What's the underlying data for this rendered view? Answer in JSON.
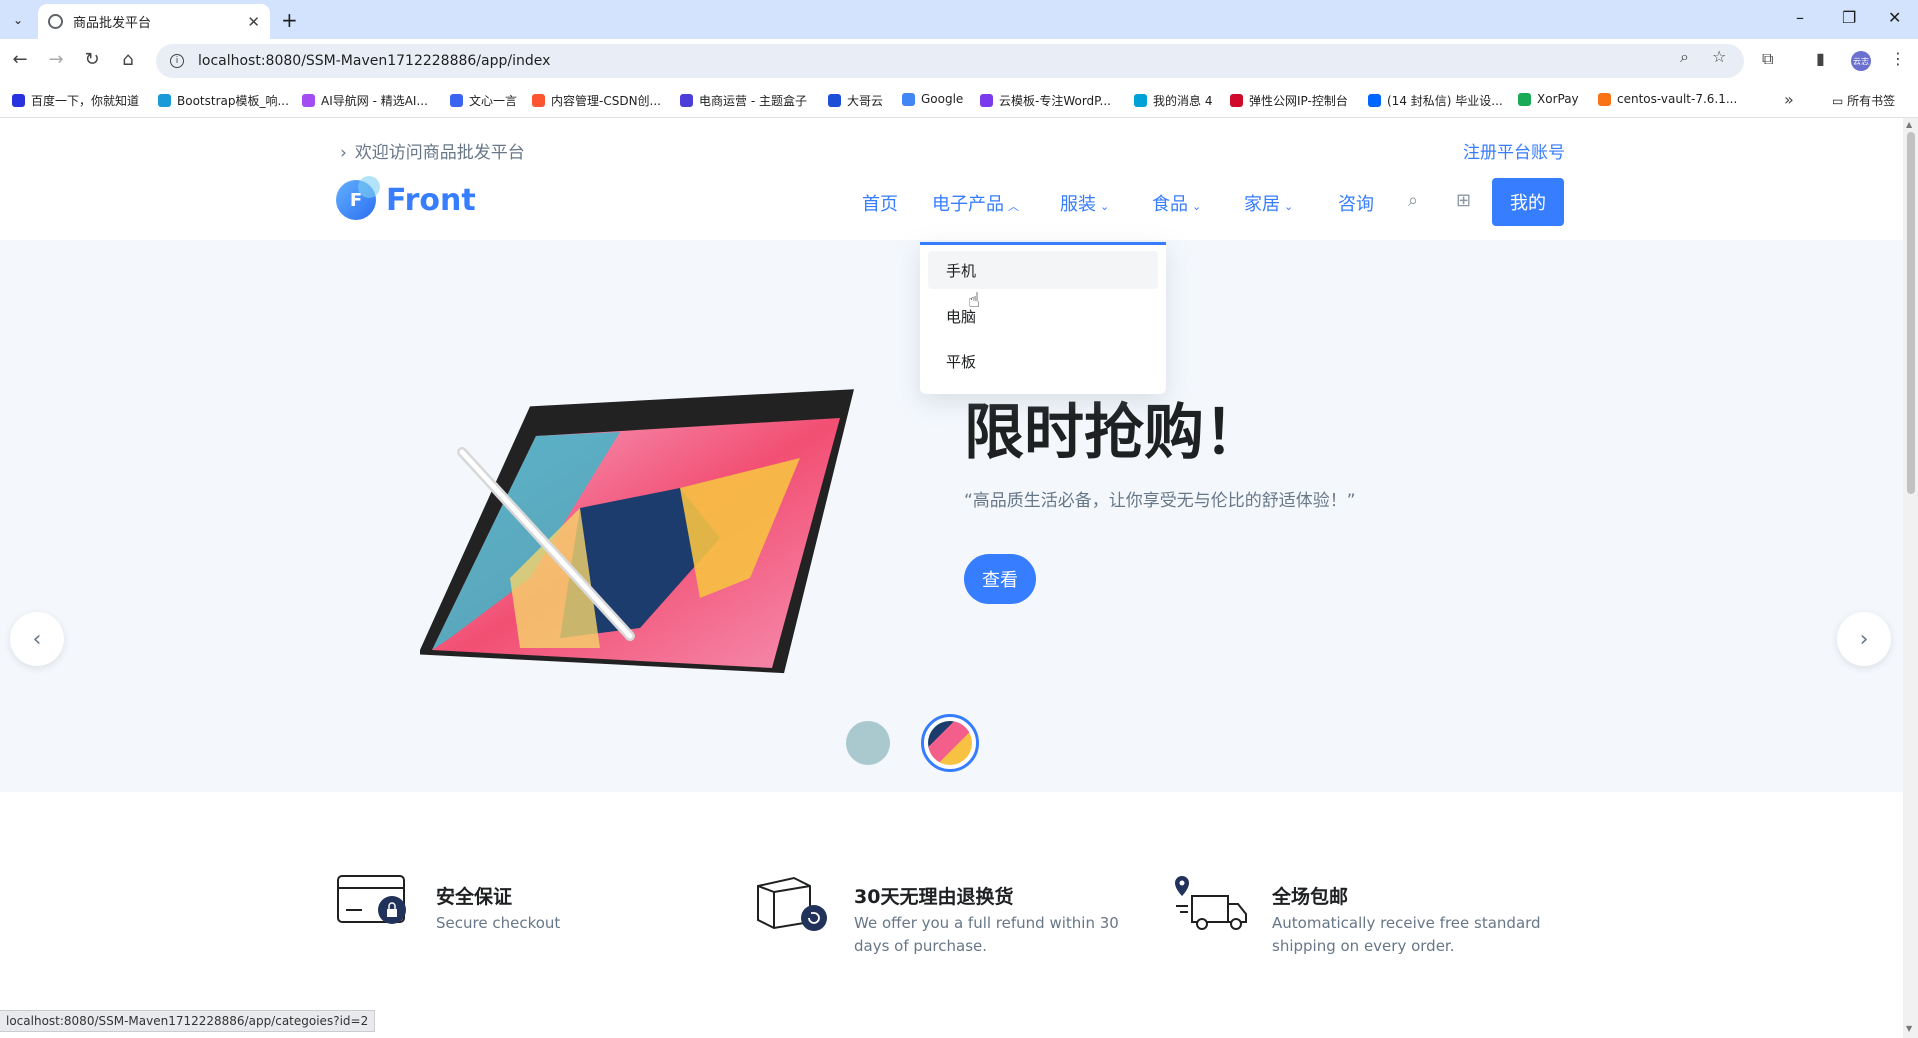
{
  "browser": {
    "tab_title": "商品批发平台",
    "url": "localhost:8080/SSM-Maven1712228886/app/index",
    "avatar_label": "云志",
    "bookmarks": [
      {
        "label": "百度一下，你就知道",
        "color": "#2932e1"
      },
      {
        "label": "Bootstrap模板_响...",
        "color": "#1a9bd7"
      },
      {
        "label": "AI导航网 - 精选AI...",
        "color": "#a24df2"
      },
      {
        "label": "文心一言",
        "color": "#3b64f0"
      },
      {
        "label": "内容管理-CSDN创...",
        "color": "#fc5531"
      },
      {
        "label": "电商运营 - 主题盒子",
        "color": "#4c3ed8"
      },
      {
        "label": "大哥云",
        "color": "#1d4ed8"
      },
      {
        "label": "Google",
        "color": "#4285f4"
      },
      {
        "label": "云模板-专注WordP...",
        "color": "#7c3aed"
      },
      {
        "label": "我的消息 4",
        "color": "#00a1d6"
      },
      {
        "label": "弹性公网IP-控制台",
        "color": "#cf0a2c"
      },
      {
        "label": "(14 封私信) 毕业设...",
        "color": "#0066ff"
      },
      {
        "label": "XorPay",
        "color": "#1aaa55"
      },
      {
        "label": "centos-vault-7.6.1...",
        "color": "#f97316"
      }
    ],
    "all_bookmarks": "所有书签",
    "status_url": "localhost:8080/SSM-Maven1712228886/app/categoies?id=2"
  },
  "header": {
    "welcome": "欢迎访问商品批发平台",
    "register": "注册平台账号",
    "logo_letter": "F",
    "logo_text": "Front",
    "nav": [
      {
        "label": "首页"
      },
      {
        "label": "电子产品"
      },
      {
        "label": "服装"
      },
      {
        "label": "食品"
      },
      {
        "label": "家居"
      },
      {
        "label": "咨询"
      }
    ],
    "my_button": "我的"
  },
  "dropdown": {
    "items": [
      "手机",
      "电脑",
      "平板"
    ]
  },
  "hero": {
    "title": "限时抢购！",
    "quote": "“高品质生活必备，让你享受无与伦比的舒适体验！”",
    "button": "查看"
  },
  "features": [
    {
      "title": "安全保证",
      "desc": "Secure checkout",
      "icon": "card-lock-icon"
    },
    {
      "title": "30天无理由退换货",
      "desc": "We offer you a full refund within 30 days of purchase.",
      "icon": "box-return-icon"
    },
    {
      "title": "全场包邮",
      "desc": "Automatically receive free standard shipping on every order.",
      "icon": "truck-icon"
    }
  ],
  "colors": {
    "primary": "#377dff",
    "hero_bg": "#f4f8fd",
    "text_muted": "#677788"
  }
}
